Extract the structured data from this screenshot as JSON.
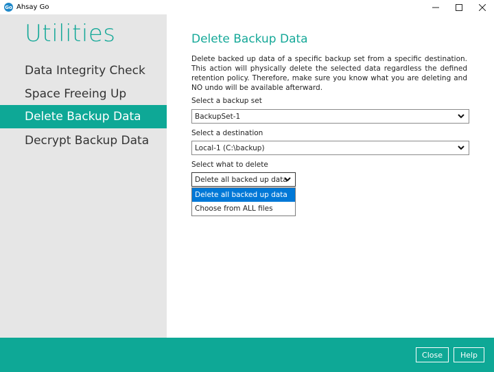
{
  "window": {
    "app_icon": "Go",
    "title": "Ahsay Go",
    "controls": {
      "minimize": "—",
      "maximize": "☐",
      "close": "✕"
    }
  },
  "sidebar": {
    "title": "Utilities",
    "items": [
      {
        "label": "Data Integrity Check",
        "active": false
      },
      {
        "label": "Space Freeing Up",
        "active": false
      },
      {
        "label": "Delete Backup Data",
        "active": true
      },
      {
        "label": "Decrypt Backup Data",
        "active": false
      }
    ]
  },
  "main": {
    "heading": "Delete Backup Data",
    "description": "Delete backed up data of a specific backup set from a specific destination. This action will physically delete the selected data regardless the defined retention policy. Therefore, make sure you know what you are deleting and NO undo will be available afterward.",
    "backup_set": {
      "label": "Select a backup set",
      "value": "BackupSet-1"
    },
    "destination": {
      "label": "Select a destination",
      "value": "Local-1 (C:\\backup)"
    },
    "what_to_delete": {
      "label": "Select what to delete",
      "value": "Delete all backed up data",
      "options": [
        {
          "label": "Delete all backed up data",
          "highlighted": true
        },
        {
          "label": "Choose from ALL files",
          "highlighted": false
        }
      ]
    }
  },
  "footer": {
    "close_label": "Close",
    "help_label": "Help"
  },
  "colors": {
    "accent": "#0ea896",
    "sidebar_bg": "#e6e6e6",
    "selection": "#0078d7"
  }
}
